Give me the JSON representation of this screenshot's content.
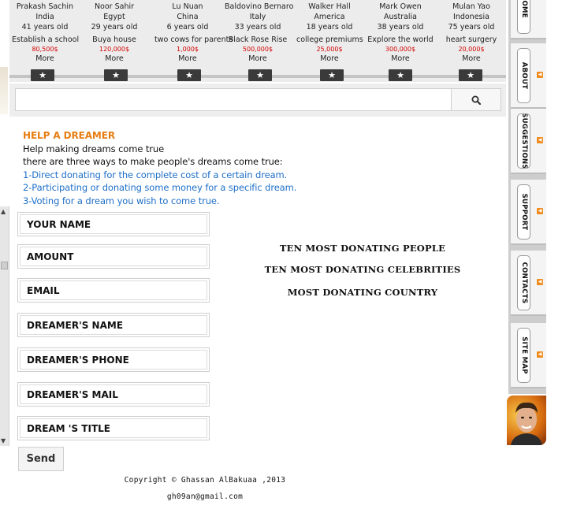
{
  "dreamers": [
    {
      "name": "Prakash Sachin",
      "country": "India",
      "age": "41 years old",
      "dream": "Establish a school",
      "cost": "80,500$",
      "more": "More"
    },
    {
      "name": "Noor  Sahir",
      "country": "Egypt",
      "age": "29 years old",
      "dream": "Buya house",
      "cost": "120,000$",
      "more": "More"
    },
    {
      "name": "Lu  Nuan",
      "country": "China",
      "age": "6 years old",
      "dream": "two cows for parents",
      "cost": "1,000$",
      "more": "More"
    },
    {
      "name": "Baldovino  Bernaro",
      "country": "Italy",
      "age": "33 years old",
      "dream": "Black Rose Rise",
      "cost": "500,000$",
      "more": "More"
    },
    {
      "name": "Walker  Hall",
      "country": "America",
      "age": "18 years old",
      "dream": "college premiums",
      "cost": "25,000$",
      "more": "More"
    },
    {
      "name": "Mark Owen",
      "country": "Australia",
      "age": "38 years old",
      "dream": "Explore the world",
      "cost": "300,000$",
      "more": "More"
    },
    {
      "name": "Mulan Yao",
      "country": "Indonesia",
      "age": "75 years old",
      "dream": "heart surgery",
      "cost": "20,000$",
      "more": "More"
    }
  ],
  "star_icon": "star-icon",
  "search": {
    "placeholder": "",
    "icon": "search-icon"
  },
  "help": {
    "title": "HELP A DREAMER",
    "line1": "Help making dreams come true",
    "line2": "there are three ways to make people's dreams come true:",
    "way1": "1-Direct donating for the complete cost of a certain dream.",
    "way2": "2-Participating or donating some money for a specific dream.",
    "way3": "3-Voting for a dream you wish to come true."
  },
  "form": {
    "your_name": "YOUR NAME",
    "amount": "AMOUNT",
    "email": "EMAIL",
    "dreamer_name": "DREAMER'S NAME",
    "dreamer_phone": "DREAMER'S PHONE",
    "dreamer_mail": "DREAMER'S MAIL",
    "dream_title": "DREAM 'S TITLE",
    "send": "Send"
  },
  "stats": {
    "people": "TEN MOST DONATING PEOPLE",
    "celebrities": "TEN MOST DONATING CELEBRITIES",
    "country": "MOST DONATING COUNTRY"
  },
  "footer": {
    "copyright": "Copyright © Ghassan AlBakuaa ,2013",
    "email": "gh09an@gmail.com"
  },
  "nav": {
    "home": "HOME",
    "about": "ABOUT",
    "suggestions": "SUGGESTIONS",
    "support": "SUPPORT",
    "contacts": "CONTACTS",
    "site_map": "SITE MAP",
    "arrow_icon": "arrow-left-icon"
  },
  "colors": {
    "accent": "#e67e14",
    "link": "#1e6fc8",
    "cost": "#d40000"
  }
}
